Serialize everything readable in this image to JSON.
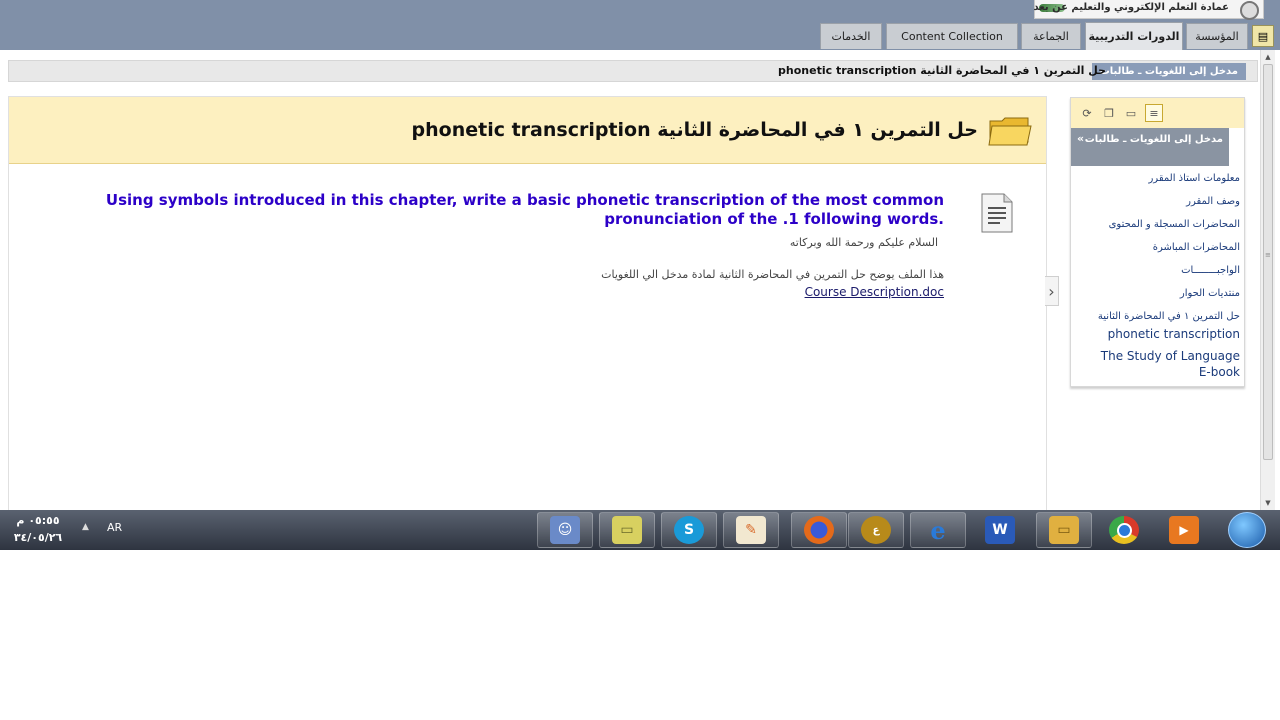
{
  "header": {
    "logo_text": "عمادة التعلم الإلكتروني والتعليم عن بعد",
    "tabs": [
      {
        "label": "المؤسسة",
        "active": false
      },
      {
        "label": "الدورات التدريبية",
        "active": true
      },
      {
        "label": "الجماعة",
        "active": false
      },
      {
        "label": "Content Collection",
        "active": false
      },
      {
        "label": "الخدمات",
        "active": false
      }
    ]
  },
  "breadcrumb": {
    "course": "مدخل إلى اللغويات ـ طالبات",
    "current": "حل التمرين ١ في المحاضرة الثانية phonetic transcription"
  },
  "content": {
    "page_title": "حل التمرين ١ في المحاضرة الثانية phonetic transcription",
    "item": {
      "title": "Using symbols introduced in this chapter, write a basic phonetic transcription of the most common pronunciation of the .1 following words.",
      "greeting": "السلام عليكم ورحمة الله وبركاته",
      "description": "هذا الملف يوضح حل التمرين في المحاضرة الثانية لمادة مدخل الي اللغويات",
      "attachment": "Course Description.doc"
    }
  },
  "menu": {
    "course_title": "مدخل إلى اللغويات ـ طالبات",
    "items": [
      "معلومات استاذ المقرر",
      "وصف المقرر",
      "المحاضرات المسجلة و المحتوى",
      "المحاضرات المباشرة",
      "الواجبــــــــات",
      "منتديات الحوار",
      "حل التمرين ١ في المحاضرة الثانية",
      "phonetic transcription",
      "The Study of Language",
      "E-book"
    ]
  },
  "taskbar": {
    "time": "٠٥:٥٥ م",
    "date": "٣٤/٠٥/٢٦",
    "language": "AR",
    "apps": [
      {
        "name": "messenger-icon",
        "color": "#6a8ac8"
      },
      {
        "name": "sticky-notes-icon",
        "color": "#d8d060"
      },
      {
        "name": "skype-icon",
        "color": "#1a9ad8"
      },
      {
        "name": "paint-icon",
        "color": "#d86a2a"
      },
      {
        "name": "firefox-icon",
        "color": "#e46a1a"
      },
      {
        "name": "alwaraq-icon",
        "color": "#b88a1a"
      },
      {
        "name": "internet-explorer-icon",
        "color": "#2a7ad8"
      },
      {
        "name": "word-icon",
        "color": "#2a5ab8"
      },
      {
        "name": "explorer-icon",
        "color": "#e0b040"
      },
      {
        "name": "chrome-icon",
        "color": "#3aa848"
      },
      {
        "name": "media-player-icon",
        "color": "#e87820"
      }
    ]
  }
}
